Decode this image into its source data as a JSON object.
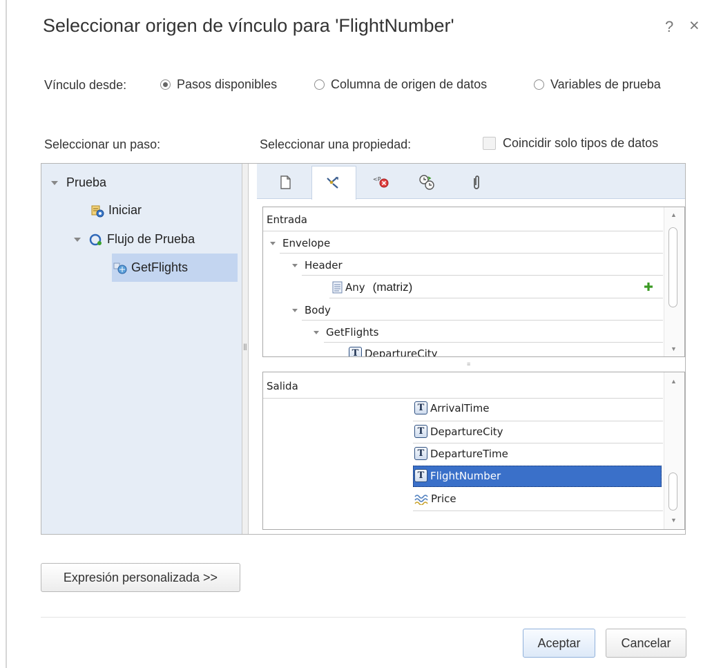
{
  "dialog": {
    "title": "Seleccionar origen de vínculo para 'FlightNumber'",
    "help_glyph": "?",
    "close_glyph": "×"
  },
  "link_from": {
    "label": "Vínculo desde:",
    "options": [
      {
        "label": "Pasos disponibles",
        "selected": true
      },
      {
        "label": "Columna de origen de datos",
        "selected": false
      },
      {
        "label": "Variables de prueba",
        "selected": false
      }
    ]
  },
  "select_step_label": "Seleccionar un paso:",
  "select_property_label": "Seleccionar una propiedad:",
  "match_types": {
    "label": "Coincidir solo tipos de datos",
    "checked": false
  },
  "step_tree": {
    "root": "Prueba",
    "start": "Iniciar",
    "flow": "Flujo de Prueba",
    "selected_step": "GetFlights"
  },
  "tabs": [
    {
      "icon": "document-icon",
      "active": false
    },
    {
      "icon": "link-arrows-icon",
      "active": true
    },
    {
      "icon": "checkpoint-error-icon",
      "active": false
    },
    {
      "icon": "events-icon",
      "active": false
    },
    {
      "icon": "attachment-icon",
      "active": false
    }
  ],
  "input_grid": {
    "header": "Entrada",
    "rows": {
      "envelope": "Envelope",
      "header": "Header",
      "any": "Any",
      "any_type": "(matriz)",
      "body": "Body",
      "getflights": "GetFlights",
      "departure_city": "DepartureCity"
    },
    "t_glyph": "T"
  },
  "output_grid": {
    "header": "Salida",
    "rows": [
      "ArrivalTime",
      "DepartureCity",
      "DepartureTime",
      "FlightNumber",
      "Price"
    ],
    "selected": "FlightNumber"
  },
  "buttons": {
    "custom_expression": "Expresión personalizada >>",
    "accept": "Aceptar",
    "cancel": "Cancelar"
  },
  "colors": {
    "selection": "#3a70c9",
    "pane_background": "#e6edf6",
    "step_selection": "#c3d5f0",
    "add_icon": "#3b9a24"
  }
}
